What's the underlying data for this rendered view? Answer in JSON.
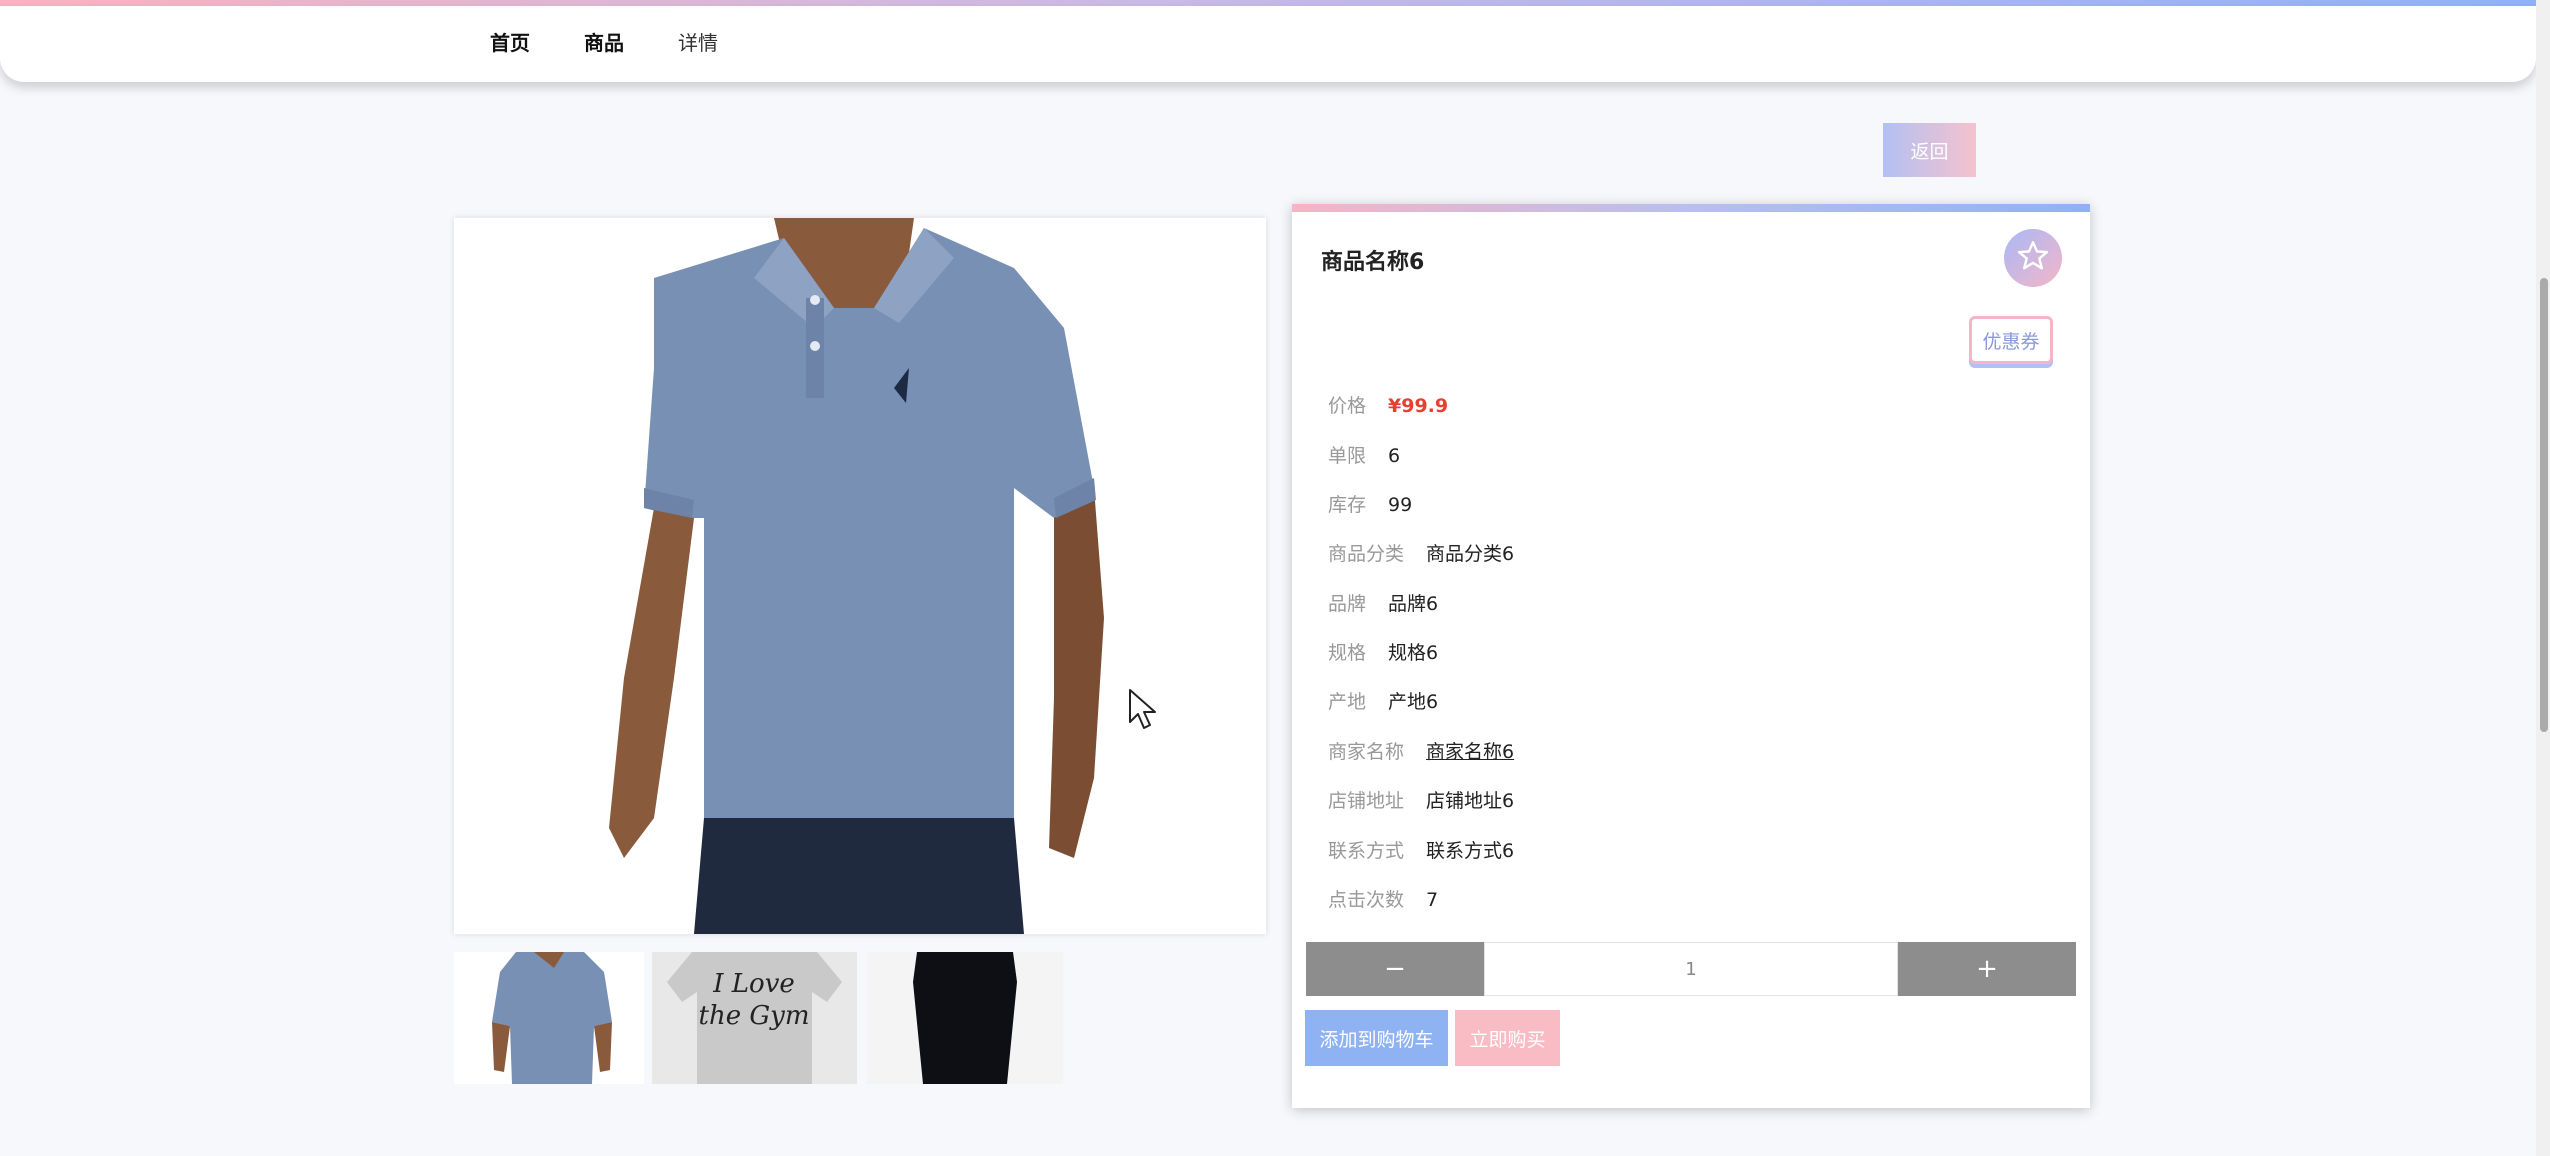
{
  "nav": {
    "items": [
      {
        "label": "首页"
      },
      {
        "label": "商品"
      },
      {
        "label": "详情"
      }
    ]
  },
  "back_button": {
    "label": "返回"
  },
  "product": {
    "title": "商品名称6",
    "coupon_label": "优惠券",
    "fields": [
      {
        "label": "价格",
        "value": "¥99.9"
      },
      {
        "label": "单限",
        "value": "6"
      },
      {
        "label": "库存",
        "value": "99"
      },
      {
        "label": "商品分类",
        "value": "商品分类6"
      },
      {
        "label": "品牌",
        "value": "品牌6"
      },
      {
        "label": "规格",
        "value": "规格6"
      },
      {
        "label": "产地",
        "value": "产地6"
      },
      {
        "label": "商家名称",
        "value": "商家名称6"
      },
      {
        "label": "店铺地址",
        "value": "店铺地址6"
      },
      {
        "label": "联系方式",
        "value": "联系方式6"
      },
      {
        "label": "点击次数",
        "value": "7"
      }
    ],
    "quantity": "1",
    "minus_label": "−",
    "plus_label": "+",
    "add_to_cart_label": "添加到购物车",
    "buy_now_label": "立即购买"
  },
  "colors": {
    "accent_blue": "#8fb2f3",
    "accent_pink": "#f6b4c4",
    "price_red": "#e8402f"
  },
  "icons": {
    "favorite": "star-icon",
    "cursor": "mouse-cursor-icon"
  }
}
